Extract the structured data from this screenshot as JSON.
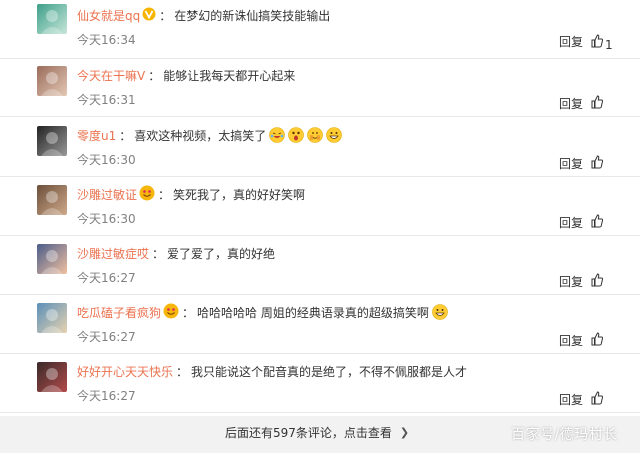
{
  "comments": [
    {
      "user": "仙女就是qq",
      "text": "在梦幻的新诛仙搞笑技能输出",
      "time": "今天16:34",
      "reply": "回复",
      "likes": "1",
      "badge": "v",
      "emojis": []
    },
    {
      "user": "今天在干嘛V",
      "text": "能够让我每天都开心起来",
      "time": "今天16:31",
      "reply": "回复",
      "likes": "",
      "badge": "",
      "emojis": []
    },
    {
      "user": "零度u1",
      "text": "喜欢这种视频，太搞笑了",
      "time": "今天16:30",
      "reply": "回复",
      "likes": "",
      "badge": "",
      "emojis": [
        "cry-laugh-emoji",
        "shocked-emoji",
        "covering-face-emoji",
        "grin-emoji"
      ]
    },
    {
      "user": "沙雕过敏证",
      "text": "笑死我了，真的好好笑啊",
      "time": "今天16:30",
      "reply": "回复",
      "likes": "",
      "badge": "heart",
      "emojis": []
    },
    {
      "user": "沙雕过敏症哎",
      "text": "爱了爱了，真的好绝",
      "time": "今天16:27",
      "reply": "回复",
      "likes": "",
      "badge": "",
      "emojis": []
    },
    {
      "user": "吃瓜磕子看疯狗",
      "text": "哈哈哈哈哈 周姐的经典语录真的超级搞笑啊",
      "time": "今天16:27",
      "reply": "回复",
      "likes": "",
      "badge": "heart",
      "emojis": [
        "grin-emoji"
      ]
    },
    {
      "user": "好好开心天天快乐",
      "text": "我只能说这个配音真的是绝了，不得不佩服都是人才",
      "time": "今天16:27",
      "reply": "回复",
      "likes": "",
      "badge": "",
      "emojis": []
    }
  ],
  "footer": {
    "more_label": "后面还有597条评论，点击查看"
  },
  "watermark": "百家号/德玛村长",
  "colors": {
    "username": "#eb7350",
    "time": "#808080",
    "footer_bg": "#f2f2f2"
  }
}
